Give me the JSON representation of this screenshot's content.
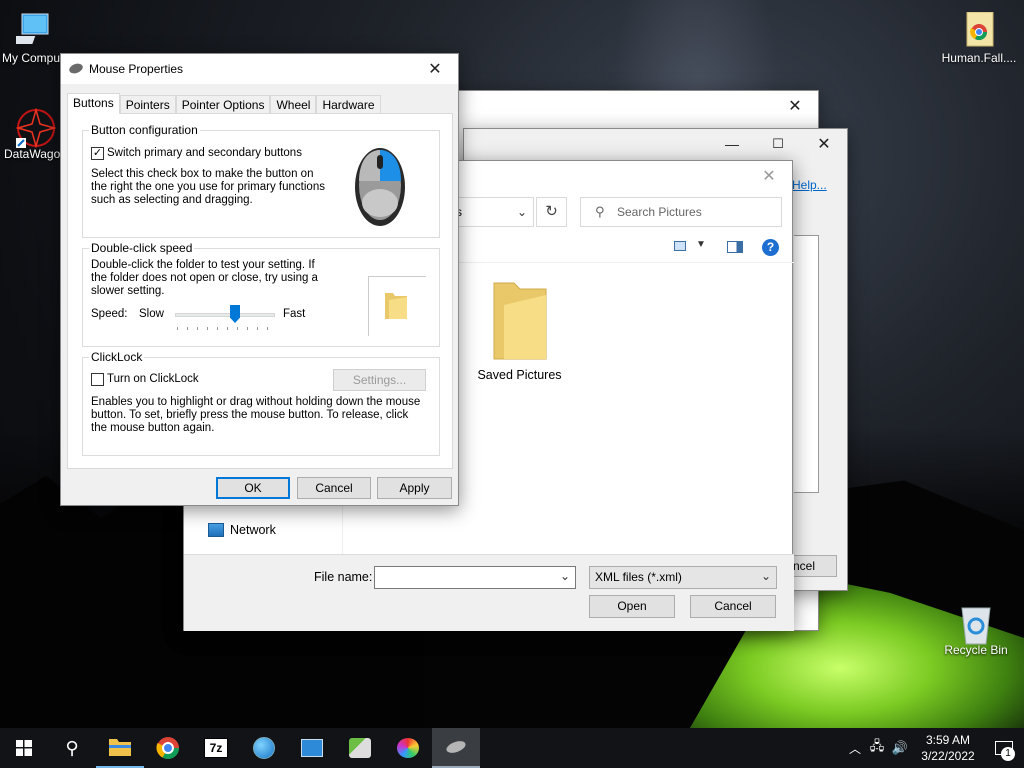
{
  "desktop": {
    "icons": [
      {
        "label": "My Compu"
      },
      {
        "label": "DataWago"
      },
      {
        "label": "Human.Fall...."
      },
      {
        "label": "Recycle Bin"
      }
    ]
  },
  "bg_window": {
    "help_link": "Help..."
  },
  "dialog2": {
    "cancel_label": "ncel"
  },
  "save_as": {
    "address_fragment": "s",
    "search_placeholder": "Search Pictures",
    "folder_name": "Saved Pictures",
    "nav_network": "Network",
    "filename_label": "File name:",
    "filename_value": "",
    "filetype_value": "XML files (*.xml)",
    "open_label": "Open",
    "cancel_label": "Cancel"
  },
  "mouse_props": {
    "title": "Mouse Properties",
    "tabs": [
      "Buttons",
      "Pointers",
      "Pointer Options",
      "Wheel",
      "Hardware"
    ],
    "selected_tab": "Buttons",
    "button_config": {
      "title": "Button configuration",
      "switch_label": "Switch primary and secondary buttons",
      "switch_checked": true,
      "description": "Select this check box to make the button on the right the one you use for primary functions such as selecting and dragging."
    },
    "double_click": {
      "title": "Double-click speed",
      "description": "Double-click the folder to test your setting. If the folder does not open or close, try using a slower setting.",
      "speed_label": "Speed:",
      "slow_label": "Slow",
      "fast_label": "Fast",
      "slider_value": 0.6
    },
    "clicklock": {
      "title": "ClickLock",
      "turn_on_label": "Turn on ClickLock",
      "turn_on_checked": false,
      "settings_label": "Settings...",
      "description": "Enables you to highlight or drag without holding down the mouse button. To set, briefly press the mouse button. To release, click the mouse button again."
    },
    "ok_label": "OK",
    "cancel_label": "Cancel",
    "apply_label": "Apply"
  },
  "taskbar": {
    "apps": [
      "start-icon",
      "search-icon",
      "file-explorer-icon",
      "chrome-icon",
      "7zip-icon",
      "network-globe-icon",
      "control-panel-icon",
      "install-icon",
      "paint-icon",
      "mouse-icon"
    ],
    "time": "3:59 AM",
    "date": "3/22/2022",
    "notification_count": "1"
  }
}
